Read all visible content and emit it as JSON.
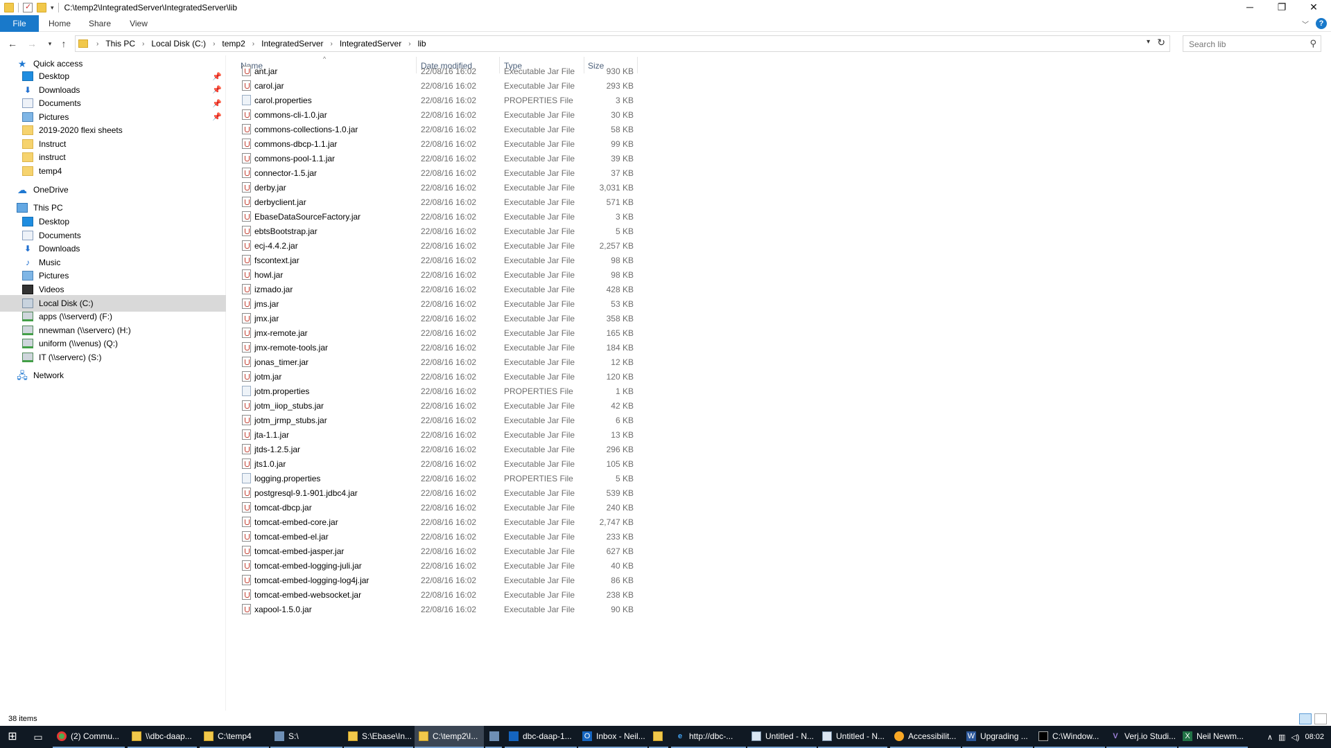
{
  "window": {
    "title": "C:\\temp2\\IntegratedServer\\IntegratedServer\\lib",
    "controls": {
      "minimize": "─",
      "maximize": "❐",
      "close": "✕"
    }
  },
  "ribbon": {
    "tabs": [
      "File",
      "Home",
      "Share",
      "View"
    ],
    "help": "?"
  },
  "address": {
    "breadcrumbs": [
      "This PC",
      "Local Disk (C:)",
      "temp2",
      "IntegratedServer",
      "IntegratedServer",
      "lib"
    ],
    "search_placeholder": "Search lib"
  },
  "nav_pane": {
    "quick_access": {
      "label": "Quick access",
      "items": [
        {
          "label": "Desktop",
          "icon": "desktop-icon",
          "pinned": true
        },
        {
          "label": "Downloads",
          "icon": "download-icon",
          "pinned": true
        },
        {
          "label": "Documents",
          "icon": "documents-icon",
          "pinned": true
        },
        {
          "label": "Pictures",
          "icon": "pictures-icon",
          "pinned": true
        },
        {
          "label": "2019-2020 flexi sheets",
          "icon": "folder-icon",
          "pinned": false
        },
        {
          "label": "Instruct",
          "icon": "folder-icon",
          "pinned": false
        },
        {
          "label": "instruct",
          "icon": "folder-icon",
          "pinned": false
        },
        {
          "label": "temp4",
          "icon": "folder-icon",
          "pinned": false
        }
      ]
    },
    "onedrive": {
      "label": "OneDrive"
    },
    "this_pc": {
      "label": "This PC",
      "items": [
        {
          "label": "Desktop",
          "icon": "desktop-icon"
        },
        {
          "label": "Documents",
          "icon": "documents-icon"
        },
        {
          "label": "Downloads",
          "icon": "download-icon"
        },
        {
          "label": "Music",
          "icon": "music-icon"
        },
        {
          "label": "Pictures",
          "icon": "pictures-icon"
        },
        {
          "label": "Videos",
          "icon": "videos-icon"
        },
        {
          "label": "Local Disk (C:)",
          "icon": "local-disk-icon",
          "selected": true
        },
        {
          "label": "apps (\\\\serverd) (F:)",
          "icon": "network-drive-icon"
        },
        {
          "label": "nnewman (\\\\serverc) (H:)",
          "icon": "network-drive-icon"
        },
        {
          "label": "uniform (\\\\venus) (Q:)",
          "icon": "network-drive-icon"
        },
        {
          "label": "IT (\\\\serverc) (S:)",
          "icon": "network-drive-icon"
        }
      ]
    },
    "network": {
      "label": "Network"
    }
  },
  "file_list": {
    "columns": [
      "Name",
      "Date modified",
      "Type",
      "Size"
    ],
    "files": [
      {
        "name": "ant.jar",
        "date": "22/08/16 16:02",
        "type": "Executable Jar File",
        "size": "930 KB"
      },
      {
        "name": "carol.jar",
        "date": "22/08/16 16:02",
        "type": "Executable Jar File",
        "size": "293 KB"
      },
      {
        "name": "carol.properties",
        "date": "22/08/16 16:02",
        "type": "PROPERTIES File",
        "size": "3 KB"
      },
      {
        "name": "commons-cli-1.0.jar",
        "date": "22/08/16 16:02",
        "type": "Executable Jar File",
        "size": "30 KB"
      },
      {
        "name": "commons-collections-1.0.jar",
        "date": "22/08/16 16:02",
        "type": "Executable Jar File",
        "size": "58 KB"
      },
      {
        "name": "commons-dbcp-1.1.jar",
        "date": "22/08/16 16:02",
        "type": "Executable Jar File",
        "size": "99 KB"
      },
      {
        "name": "commons-pool-1.1.jar",
        "date": "22/08/16 16:02",
        "type": "Executable Jar File",
        "size": "39 KB"
      },
      {
        "name": "connector-1.5.jar",
        "date": "22/08/16 16:02",
        "type": "Executable Jar File",
        "size": "37 KB"
      },
      {
        "name": "derby.jar",
        "date": "22/08/16 16:02",
        "type": "Executable Jar File",
        "size": "3,031 KB"
      },
      {
        "name": "derbyclient.jar",
        "date": "22/08/16 16:02",
        "type": "Executable Jar File",
        "size": "571 KB"
      },
      {
        "name": "EbaseDataSourceFactory.jar",
        "date": "22/08/16 16:02",
        "type": "Executable Jar File",
        "size": "3 KB"
      },
      {
        "name": "ebtsBootstrap.jar",
        "date": "22/08/16 16:02",
        "type": "Executable Jar File",
        "size": "5 KB"
      },
      {
        "name": "ecj-4.4.2.jar",
        "date": "22/08/16 16:02",
        "type": "Executable Jar File",
        "size": "2,257 KB"
      },
      {
        "name": "fscontext.jar",
        "date": "22/08/16 16:02",
        "type": "Executable Jar File",
        "size": "98 KB"
      },
      {
        "name": "howl.jar",
        "date": "22/08/16 16:02",
        "type": "Executable Jar File",
        "size": "98 KB"
      },
      {
        "name": "izmado.jar",
        "date": "22/08/16 16:02",
        "type": "Executable Jar File",
        "size": "428 KB"
      },
      {
        "name": "jms.jar",
        "date": "22/08/16 16:02",
        "type": "Executable Jar File",
        "size": "53 KB"
      },
      {
        "name": "jmx.jar",
        "date": "22/08/16 16:02",
        "type": "Executable Jar File",
        "size": "358 KB"
      },
      {
        "name": "jmx-remote.jar",
        "date": "22/08/16 16:02",
        "type": "Executable Jar File",
        "size": "165 KB"
      },
      {
        "name": "jmx-remote-tools.jar",
        "date": "22/08/16 16:02",
        "type": "Executable Jar File",
        "size": "184 KB"
      },
      {
        "name": "jonas_timer.jar",
        "date": "22/08/16 16:02",
        "type": "Executable Jar File",
        "size": "12 KB"
      },
      {
        "name": "jotm.jar",
        "date": "22/08/16 16:02",
        "type": "Executable Jar File",
        "size": "120 KB"
      },
      {
        "name": "jotm.properties",
        "date": "22/08/16 16:02",
        "type": "PROPERTIES File",
        "size": "1 KB"
      },
      {
        "name": "jotm_iiop_stubs.jar",
        "date": "22/08/16 16:02",
        "type": "Executable Jar File",
        "size": "42 KB"
      },
      {
        "name": "jotm_jrmp_stubs.jar",
        "date": "22/08/16 16:02",
        "type": "Executable Jar File",
        "size": "6 KB"
      },
      {
        "name": "jta-1.1.jar",
        "date": "22/08/16 16:02",
        "type": "Executable Jar File",
        "size": "13 KB"
      },
      {
        "name": "jtds-1.2.5.jar",
        "date": "22/08/16 16:02",
        "type": "Executable Jar File",
        "size": "296 KB"
      },
      {
        "name": "jts1.0.jar",
        "date": "22/08/16 16:02",
        "type": "Executable Jar File",
        "size": "105 KB"
      },
      {
        "name": "logging.properties",
        "date": "22/08/16 16:02",
        "type": "PROPERTIES File",
        "size": "5 KB"
      },
      {
        "name": "postgresql-9.1-901.jdbc4.jar",
        "date": "22/08/16 16:02",
        "type": "Executable Jar File",
        "size": "539 KB"
      },
      {
        "name": "tomcat-dbcp.jar",
        "date": "22/08/16 16:02",
        "type": "Executable Jar File",
        "size": "240 KB"
      },
      {
        "name": "tomcat-embed-core.jar",
        "date": "22/08/16 16:02",
        "type": "Executable Jar File",
        "size": "2,747 KB"
      },
      {
        "name": "tomcat-embed-el.jar",
        "date": "22/08/16 16:02",
        "type": "Executable Jar File",
        "size": "233 KB"
      },
      {
        "name": "tomcat-embed-jasper.jar",
        "date": "22/08/16 16:02",
        "type": "Executable Jar File",
        "size": "627 KB"
      },
      {
        "name": "tomcat-embed-logging-juli.jar",
        "date": "22/08/16 16:02",
        "type": "Executable Jar File",
        "size": "40 KB"
      },
      {
        "name": "tomcat-embed-logging-log4j.jar",
        "date": "22/08/16 16:02",
        "type": "Executable Jar File",
        "size": "86 KB"
      },
      {
        "name": "tomcat-embed-websocket.jar",
        "date": "22/08/16 16:02",
        "type": "Executable Jar File",
        "size": "238 KB"
      },
      {
        "name": "xapool-1.5.0.jar",
        "date": "22/08/16 16:02",
        "type": "Executable Jar File",
        "size": "90 KB"
      }
    ]
  },
  "status": {
    "item_count": "38 items"
  },
  "taskbar": {
    "items": [
      {
        "label": "(2) Commu...",
        "icon": "chrome"
      },
      {
        "label": "\\\\dbc-daap...",
        "icon": "folder"
      },
      {
        "label": "C:\\temp4",
        "icon": "folder"
      },
      {
        "label": "S:\\",
        "icon": "net"
      },
      {
        "label": "S:\\Ebase\\In...",
        "icon": "folder"
      },
      {
        "label": "C:\\temp2\\I...",
        "icon": "folder",
        "active": true
      },
      {
        "label": "",
        "icon": "net"
      },
      {
        "label": "dbc-daap-1...",
        "icon": "rdp"
      },
      {
        "label": "Inbox - Neil...",
        "icon": "outlook"
      },
      {
        "label": "",
        "icon": "folder"
      },
      {
        "label": "http://dbc-...",
        "icon": "ie"
      },
      {
        "label": "Untitled - N...",
        "icon": "note"
      },
      {
        "label": "Untitled - N...",
        "icon": "note"
      },
      {
        "label": "Accessibilit...",
        "icon": "acc"
      },
      {
        "label": "Upgrading ...",
        "icon": "word"
      },
      {
        "label": "C:\\Window...",
        "icon": "cmd"
      },
      {
        "label": "Verj.io Studi...",
        "icon": "vs"
      },
      {
        "label": "Neil Newm...",
        "icon": "excel"
      }
    ],
    "clock": "08:02"
  }
}
